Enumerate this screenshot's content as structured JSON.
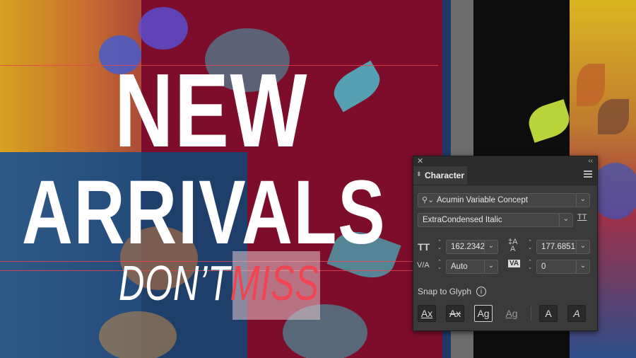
{
  "artwork": {
    "headline_line1": "NEW",
    "headline_line2": "ARRIVALS",
    "subline_part1": "DON’T",
    "subline_part2": "MISS",
    "colors": {
      "headline": "#ffffff",
      "miss_text": "#ef4651",
      "panel_red": "#7e0d2b",
      "band_blue": "#234a7a"
    }
  },
  "panel": {
    "title": "Character",
    "font_family": "Acumin Variable Concept",
    "font_style": "ExtraCondensed Italic",
    "font_size": "162.2342",
    "leading": "177.6851",
    "kerning": "Auto",
    "tracking": "0",
    "snap_label": "Snap to Glyph",
    "info_glyph": "i",
    "close_glyph": "✕",
    "collapse_glyph": "‹‹",
    "size_icon": "TT",
    "kerning_icon": "V/A",
    "tracking_icon": "VA",
    "glyph_buttons": [
      "Ax",
      "Ax",
      "Ag",
      "Ag",
      "A",
      "A"
    ]
  }
}
